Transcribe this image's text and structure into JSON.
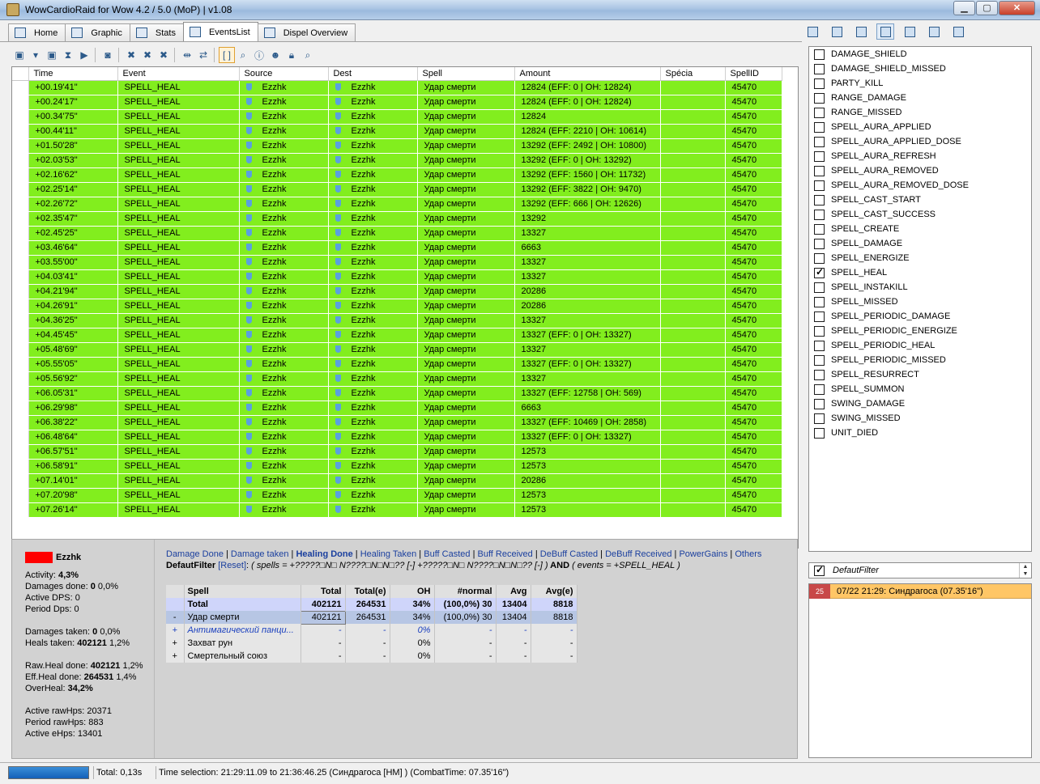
{
  "window": {
    "title": "WowCardioRaid for Wow 4.2 / 5.0 (MoP) | v1.08"
  },
  "tabs": [
    {
      "label": "Home"
    },
    {
      "label": "Graphic"
    },
    {
      "label": "Stats"
    },
    {
      "label": "EventsList"
    },
    {
      "label": "Dispel Overview"
    }
  ],
  "grid": {
    "headers": [
      "Time",
      "Event",
      "Source",
      "Dest",
      "Spell",
      "Amount",
      "Spécia",
      "SpellID"
    ],
    "rows": [
      [
        "+00.19'41\"",
        "SPELL_HEAL",
        "Ezzhk",
        "Ezzhk",
        "Удар смерти",
        "12824 (EFF: 0 | OH: 12824)",
        "",
        "45470"
      ],
      [
        "+00.24'17\"",
        "SPELL_HEAL",
        "Ezzhk",
        "Ezzhk",
        "Удар смерти",
        "12824 (EFF: 0 | OH: 12824)",
        "",
        "45470"
      ],
      [
        "+00.34'75\"",
        "SPELL_HEAL",
        "Ezzhk",
        "Ezzhk",
        "Удар смерти",
        "12824",
        "",
        "45470"
      ],
      [
        "+00.44'11\"",
        "SPELL_HEAL",
        "Ezzhk",
        "Ezzhk",
        "Удар смерти",
        "12824 (EFF: 2210 | OH: 10614)",
        "",
        "45470"
      ],
      [
        "+01.50'28\"",
        "SPELL_HEAL",
        "Ezzhk",
        "Ezzhk",
        "Удар смерти",
        "13292 (EFF: 2492 | OH: 10800)",
        "",
        "45470"
      ],
      [
        "+02.03'53\"",
        "SPELL_HEAL",
        "Ezzhk",
        "Ezzhk",
        "Удар смерти",
        "13292 (EFF: 0 | OH: 13292)",
        "",
        "45470"
      ],
      [
        "+02.16'62\"",
        "SPELL_HEAL",
        "Ezzhk",
        "Ezzhk",
        "Удар смерти",
        "13292 (EFF: 1560 | OH: 11732)",
        "",
        "45470"
      ],
      [
        "+02.25'14\"",
        "SPELL_HEAL",
        "Ezzhk",
        "Ezzhk",
        "Удар смерти",
        "13292 (EFF: 3822 | OH: 9470)",
        "",
        "45470"
      ],
      [
        "+02.26'72\"",
        "SPELL_HEAL",
        "Ezzhk",
        "Ezzhk",
        "Удар смерти",
        "13292 (EFF: 666 | OH: 12626)",
        "",
        "45470"
      ],
      [
        "+02.35'47\"",
        "SPELL_HEAL",
        "Ezzhk",
        "Ezzhk",
        "Удар смерти",
        "13292",
        "",
        "45470"
      ],
      [
        "+02.45'25\"",
        "SPELL_HEAL",
        "Ezzhk",
        "Ezzhk",
        "Удар смерти",
        "13327",
        "",
        "45470"
      ],
      [
        "+03.46'64\"",
        "SPELL_HEAL",
        "Ezzhk",
        "Ezzhk",
        "Удар смерти",
        "6663",
        "",
        "45470"
      ],
      [
        "+03.55'00\"",
        "SPELL_HEAL",
        "Ezzhk",
        "Ezzhk",
        "Удар смерти",
        "13327",
        "",
        "45470"
      ],
      [
        "+04.03'41\"",
        "SPELL_HEAL",
        "Ezzhk",
        "Ezzhk",
        "Удар смерти",
        "13327",
        "",
        "45470"
      ],
      [
        "+04.21'94\"",
        "SPELL_HEAL",
        "Ezzhk",
        "Ezzhk",
        "Удар смерти",
        "20286",
        "",
        "45470"
      ],
      [
        "+04.26'91\"",
        "SPELL_HEAL",
        "Ezzhk",
        "Ezzhk",
        "Удар смерти",
        "20286",
        "",
        "45470"
      ],
      [
        "+04.36'25\"",
        "SPELL_HEAL",
        "Ezzhk",
        "Ezzhk",
        "Удар смерти",
        "13327",
        "",
        "45470"
      ],
      [
        "+04.45'45\"",
        "SPELL_HEAL",
        "Ezzhk",
        "Ezzhk",
        "Удар смерти",
        "13327 (EFF: 0 | OH: 13327)",
        "",
        "45470"
      ],
      [
        "+05.48'69\"",
        "SPELL_HEAL",
        "Ezzhk",
        "Ezzhk",
        "Удар смерти",
        "13327",
        "",
        "45470"
      ],
      [
        "+05.55'05\"",
        "SPELL_HEAL",
        "Ezzhk",
        "Ezzhk",
        "Удар смерти",
        "13327 (EFF: 0 | OH: 13327)",
        "",
        "45470"
      ],
      [
        "+05.56'92\"",
        "SPELL_HEAL",
        "Ezzhk",
        "Ezzhk",
        "Удар смерти",
        "13327",
        "",
        "45470"
      ],
      [
        "+06.05'31\"",
        "SPELL_HEAL",
        "Ezzhk",
        "Ezzhk",
        "Удар смерти",
        "13327 (EFF: 12758 | OH: 569)",
        "",
        "45470"
      ],
      [
        "+06.29'98\"",
        "SPELL_HEAL",
        "Ezzhk",
        "Ezzhk",
        "Удар смерти",
        "6663",
        "",
        "45470"
      ],
      [
        "+06.38'22\"",
        "SPELL_HEAL",
        "Ezzhk",
        "Ezzhk",
        "Удар смерти",
        "13327 (EFF: 10469 | OH: 2858)",
        "",
        "45470"
      ],
      [
        "+06.48'64\"",
        "SPELL_HEAL",
        "Ezzhk",
        "Ezzhk",
        "Удар смерти",
        "13327 (EFF: 0 | OH: 13327)",
        "",
        "45470"
      ],
      [
        "+06.57'51\"",
        "SPELL_HEAL",
        "Ezzhk",
        "Ezzhk",
        "Удар смерти",
        "12573",
        "",
        "45470"
      ],
      [
        "+06.58'91\"",
        "SPELL_HEAL",
        "Ezzhk",
        "Ezzhk",
        "Удар смерти",
        "12573",
        "",
        "45470"
      ],
      [
        "+07.14'01\"",
        "SPELL_HEAL",
        "Ezzhk",
        "Ezzhk",
        "Удар смерти",
        "20286",
        "",
        "45470"
      ],
      [
        "+07.20'98\"",
        "SPELL_HEAL",
        "Ezzhk",
        "Ezzhk",
        "Удар смерти",
        "12573",
        "",
        "45470"
      ],
      [
        "+07.26'14\"",
        "SPELL_HEAL",
        "Ezzhk",
        "Ezzhk",
        "Удар смерти",
        "12573",
        "",
        "45470"
      ]
    ],
    "row_color": "#82ee1e"
  },
  "event_filters": [
    {
      "label": "DAMAGE_SHIELD",
      "checked": false
    },
    {
      "label": "DAMAGE_SHIELD_MISSED",
      "checked": false
    },
    {
      "label": "PARTY_KILL",
      "checked": false
    },
    {
      "label": "RANGE_DAMAGE",
      "checked": false
    },
    {
      "label": "RANGE_MISSED",
      "checked": false
    },
    {
      "label": "SPELL_AURA_APPLIED",
      "checked": false
    },
    {
      "label": "SPELL_AURA_APPLIED_DOSE",
      "checked": false
    },
    {
      "label": "SPELL_AURA_REFRESH",
      "checked": false
    },
    {
      "label": "SPELL_AURA_REMOVED",
      "checked": false
    },
    {
      "label": "SPELL_AURA_REMOVED_DOSE",
      "checked": false
    },
    {
      "label": "SPELL_CAST_START",
      "checked": false
    },
    {
      "label": "SPELL_CAST_SUCCESS",
      "checked": false
    },
    {
      "label": "SPELL_CREATE",
      "checked": false
    },
    {
      "label": "SPELL_DAMAGE",
      "checked": false
    },
    {
      "label": "SPELL_ENERGIZE",
      "checked": false
    },
    {
      "label": "SPELL_HEAL",
      "checked": true
    },
    {
      "label": "SPELL_INSTAKILL",
      "checked": false
    },
    {
      "label": "SPELL_MISSED",
      "checked": false
    },
    {
      "label": "SPELL_PERIODIC_DAMAGE",
      "checked": false
    },
    {
      "label": "SPELL_PERIODIC_ENERGIZE",
      "checked": false
    },
    {
      "label": "SPELL_PERIODIC_HEAL",
      "checked": false
    },
    {
      "label": "SPELL_PERIODIC_MISSED",
      "checked": false
    },
    {
      "label": "SPELL_RESURRECT",
      "checked": false
    },
    {
      "label": "SPELL_SUMMON",
      "checked": false
    },
    {
      "label": "SWING_DAMAGE",
      "checked": false
    },
    {
      "label": "SWING_MISSED",
      "checked": false
    },
    {
      "label": "UNIT_DIED",
      "checked": false
    }
  ],
  "filter_combo": {
    "label": "DefautFilter",
    "checked": true
  },
  "fight": {
    "number": "25",
    "text": "07/22  21:29: Синдрагоса (07.35'16\")"
  },
  "player": {
    "name": "Ezzhk",
    "color": "#ff0000",
    "stats": [
      {
        "label": "Activity: ",
        "value": "4,3%",
        "suffix": ""
      },
      {
        "label": "Damages done: ",
        "value": "0",
        "suffix": " 0,0%"
      },
      {
        "label": "Active DPS: ",
        "value": "",
        "suffix": "0"
      },
      {
        "label": "Period Dps: ",
        "value": "",
        "suffix": "0"
      },
      {
        "label": "Damages taken: ",
        "value": "0",
        "suffix": " 0,0%"
      },
      {
        "label": "Heals taken: ",
        "value": "402121",
        "suffix": " 1,2%"
      },
      {
        "label": "Raw.Heal done: ",
        "value": "402121",
        "suffix": " 1,2%"
      },
      {
        "label": "Eff.Heal done: ",
        "value": "264531",
        "suffix": " 1,4%"
      },
      {
        "label": "OverHeal: ",
        "value": "34,2%",
        "suffix": ""
      },
      {
        "label": "Active rawHps: ",
        "value": "",
        "suffix": "20371"
      },
      {
        "label": "Period rawHps: ",
        "value": "",
        "suffix": "883"
      },
      {
        "label": "Active eHps: ",
        "value": "",
        "suffix": "13401"
      }
    ]
  },
  "report_links": [
    {
      "label": "Damage Done",
      "current": false
    },
    {
      "label": "Damage taken",
      "current": false
    },
    {
      "label": "Healing Done",
      "current": true
    },
    {
      "label": "Healing Taken",
      "current": false
    },
    {
      "label": "Buff Casted",
      "current": false
    },
    {
      "label": "Buff Received",
      "current": false
    },
    {
      "label": "DeBuff Casted",
      "current": false
    },
    {
      "label": "DeBuff Received",
      "current": false
    },
    {
      "label": "PowerGains",
      "current": false
    },
    {
      "label": "Others",
      "current": false
    }
  ],
  "filter_line": {
    "name": "DefautFilter",
    "reset": "[Reset]",
    "expr_a": "( spells = +?????□N□ N????□N□N□?? [-] +?????□N□ N????□N□N□?? [-] )",
    "and": " AND ",
    "expr_b": "( events = +SPELL_HEAL )"
  },
  "spell_table": {
    "headers": [
      "",
      "Spell",
      "Total",
      "Total(e)",
      "OH",
      "#normal",
      "Avg",
      "Avg(e)"
    ],
    "rows": [
      {
        "marker": "",
        "spell": "Total",
        "total": "402121",
        "total_e": "264531",
        "oh": "34%",
        "normal": "(100,0%)  30",
        "avg": "13404",
        "avg_e": "8818",
        "style": "total"
      },
      {
        "marker": "-",
        "spell": "Удар смерти",
        "total": "402121",
        "total_e": "264531",
        "oh": "34%",
        "normal": "(100,0%)  30",
        "avg": "13404",
        "avg_e": "8818",
        "style": "sel"
      },
      {
        "marker": "+",
        "spell": "Антимагический панци...",
        "total": "-",
        "total_e": "-",
        "oh": "0%",
        "normal": "-",
        "avg": "-",
        "avg_e": "-",
        "style": "italic"
      },
      {
        "marker": "+",
        "spell": "Захват рун",
        "total": "-",
        "total_e": "-",
        "oh": "0%",
        "normal": "-",
        "avg": "-",
        "avg_e": "-",
        "style": ""
      },
      {
        "marker": "+",
        "spell": "Смертельный союз",
        "total": "-",
        "total_e": "-",
        "oh": "0%",
        "normal": "-",
        "avg": "-",
        "avg_e": "-",
        "style": ""
      }
    ]
  },
  "status": {
    "total": "Total: 0,13s",
    "time_selection": "Time selection: 21:29:11.09 to 21:36:46.25 (Синдрагоса [HM] )  (CombatTime: 07.35'16\")"
  }
}
